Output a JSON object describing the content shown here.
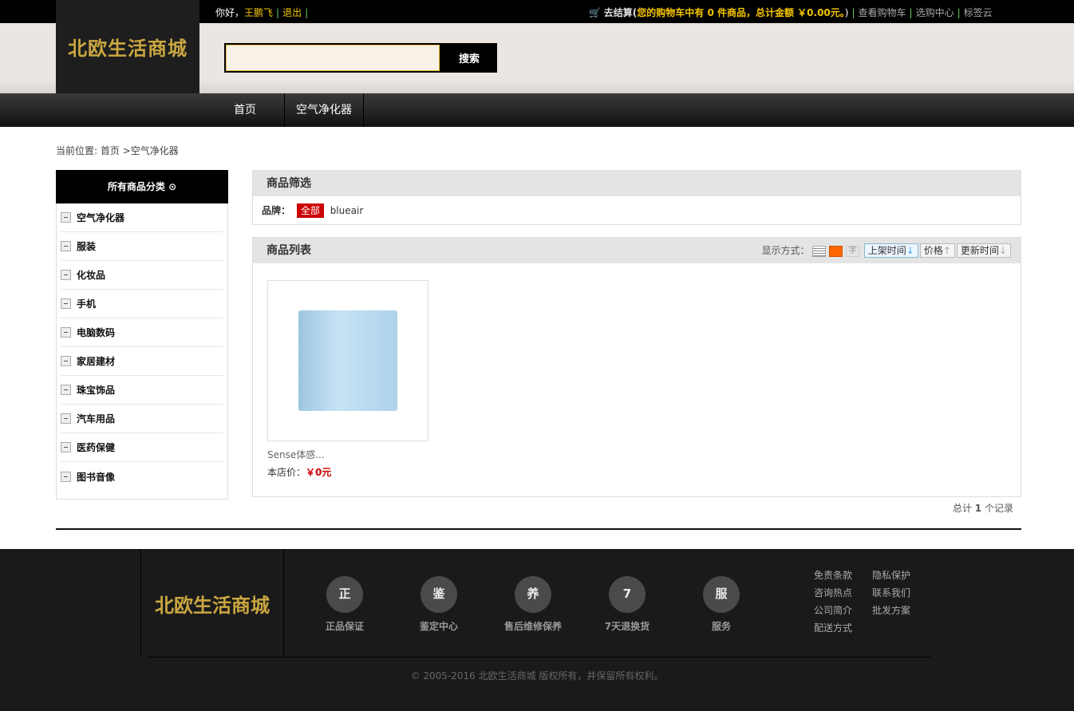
{
  "top": {
    "greeting": "你好，",
    "user": "王鹏飞",
    "logout": "退出",
    "checkout": "去结算(",
    "cart_info": "您的购物车中有 0 件商品，总计金额 ￥0.00元。",
    "close": ")",
    "links": [
      "查看购物车",
      "选购中心",
      "标签云"
    ]
  },
  "logo": "北欧生活商城",
  "search": {
    "value": "",
    "button": "搜索"
  },
  "nav": [
    "首页",
    "空气净化器"
  ],
  "breadcrumb": "当前位置: 首页 >空气净化器",
  "sidebar": {
    "title": "所有商品分类",
    "items": [
      "空气净化器",
      "服装",
      "化妆品",
      "手机",
      "电脑数码",
      "家居建材",
      "珠宝饰品",
      "汽车用品",
      "医药保健",
      "图书音像"
    ]
  },
  "filter": {
    "title": "商品筛选",
    "brand_label": "品牌：",
    "all": "全部",
    "brands": [
      "blueair"
    ]
  },
  "list": {
    "title": "商品列表",
    "display_label": "显示方式：",
    "sort": [
      "上架时间",
      "价格",
      "更新时间"
    ],
    "products": [
      {
        "name": "Sense体感...",
        "price_label": "本店价：",
        "price": "￥0元"
      }
    ],
    "total_pre": "总计",
    "total": "1",
    "total_post": "个记录"
  },
  "footer": {
    "logo": "北欧生活商城",
    "features": [
      {
        "glyph": "正",
        "label": "正品保证"
      },
      {
        "glyph": "鉴",
        "label": "鉴定中心"
      },
      {
        "glyph": "养",
        "label": "售后维修保养"
      },
      {
        "glyph": "7",
        "label": "7天退换货"
      },
      {
        "glyph": "服",
        "label": "服务"
      }
    ],
    "links": [
      "免责条款",
      "隐私保护",
      "咨询热点",
      "联系我们",
      "公司简介",
      "批发方案",
      "配送方式"
    ],
    "copyright": "© 2005-2016 北欧生活商城 版权所有，并保留所有权利。"
  }
}
